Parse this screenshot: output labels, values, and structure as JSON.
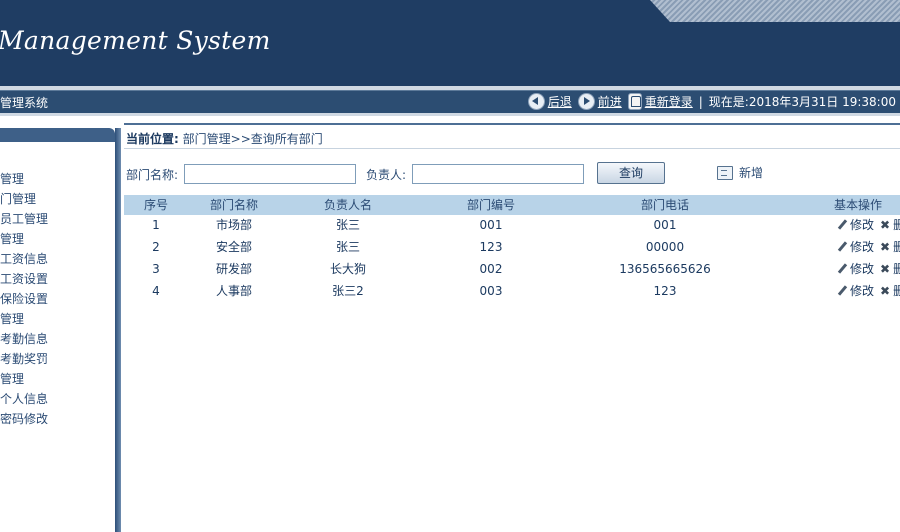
{
  "header": {
    "title": "Management System"
  },
  "navbar": {
    "system_name": "管理系统",
    "back": "后退",
    "forward": "前进",
    "relogin": "重新登录",
    "datetime": "现在是:2018年3月31日 19:38:00"
  },
  "sidebar": {
    "items": [
      {
        "label": "管理"
      },
      {
        "label": "门管理"
      },
      {
        "label": "员工管理"
      },
      {
        "label": "管理"
      },
      {
        "label": "工资信息"
      },
      {
        "label": "工资设置"
      },
      {
        "label": "保险设置"
      },
      {
        "label": "管理"
      },
      {
        "label": "考勤信息"
      },
      {
        "label": "考勤奖罚"
      },
      {
        "label": "管理"
      },
      {
        "label": "个人信息"
      },
      {
        "label": "密码修改"
      }
    ]
  },
  "breadcrumb": {
    "prefix": "当前位置:",
    "path": "部门管理>>查询所有部门"
  },
  "search": {
    "dept_label": "部门名称:",
    "dept_value": "",
    "head_label": "负责人:",
    "head_value": "",
    "query_button": "查询",
    "add_button": "新增"
  },
  "table": {
    "headers": [
      "序号",
      "部门名称",
      "负责人名",
      "部门编号",
      "部门电话",
      "基本操作"
    ],
    "rows": [
      {
        "no": "1",
        "name": "市场部",
        "head": "张三",
        "code": "001",
        "phone": "001"
      },
      {
        "no": "2",
        "name": "安全部",
        "head": "张三",
        "code": "123",
        "phone": "00000"
      },
      {
        "no": "3",
        "name": "研发部",
        "head": "长大狗",
        "code": "002",
        "phone": "136565665626"
      },
      {
        "no": "4",
        "name": "人事部",
        "head": "张三2",
        "code": "003",
        "phone": "123"
      }
    ],
    "edit_label": "修改",
    "delete_label": "删"
  }
}
